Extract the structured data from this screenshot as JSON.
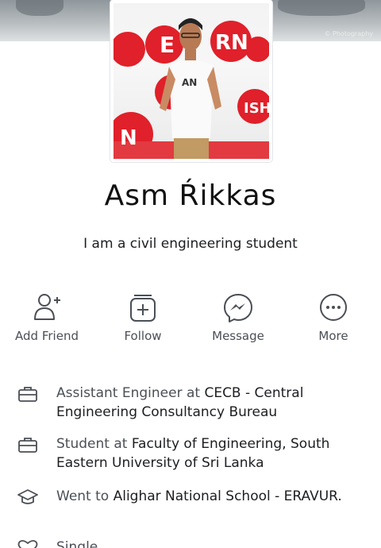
{
  "cover": {
    "credit": "© Photography"
  },
  "profile": {
    "name": "Asm Ŕikkas",
    "bio": "I am a civil engineering student"
  },
  "actions": [
    {
      "label": "Add Friend",
      "icon": "add-friend-icon"
    },
    {
      "label": "Follow",
      "icon": "follow-icon"
    },
    {
      "label": "Message",
      "icon": "messenger-icon"
    },
    {
      "label": "More",
      "icon": "more-icon"
    }
  ],
  "info": [
    {
      "icon": "briefcase-icon",
      "prefix": "Assistant Engineer at ",
      "highlight": "CECB - Central Engineering Consultancy Bureau"
    },
    {
      "icon": "briefcase-icon",
      "prefix": "Student at ",
      "highlight": "Faculty of Engineering, South Eastern University of Sri Lanka"
    },
    {
      "icon": "graduation-cap-icon",
      "prefix": "Went to ",
      "highlight": "Alighar National School - ERAVUR."
    },
    {
      "icon": "heart-icon",
      "prefix": "Single",
      "highlight": ""
    }
  ],
  "colors": {
    "icon_gray": "#4b4f56",
    "text_dark": "#1c1e21",
    "avatar_red": "#e0202a"
  }
}
